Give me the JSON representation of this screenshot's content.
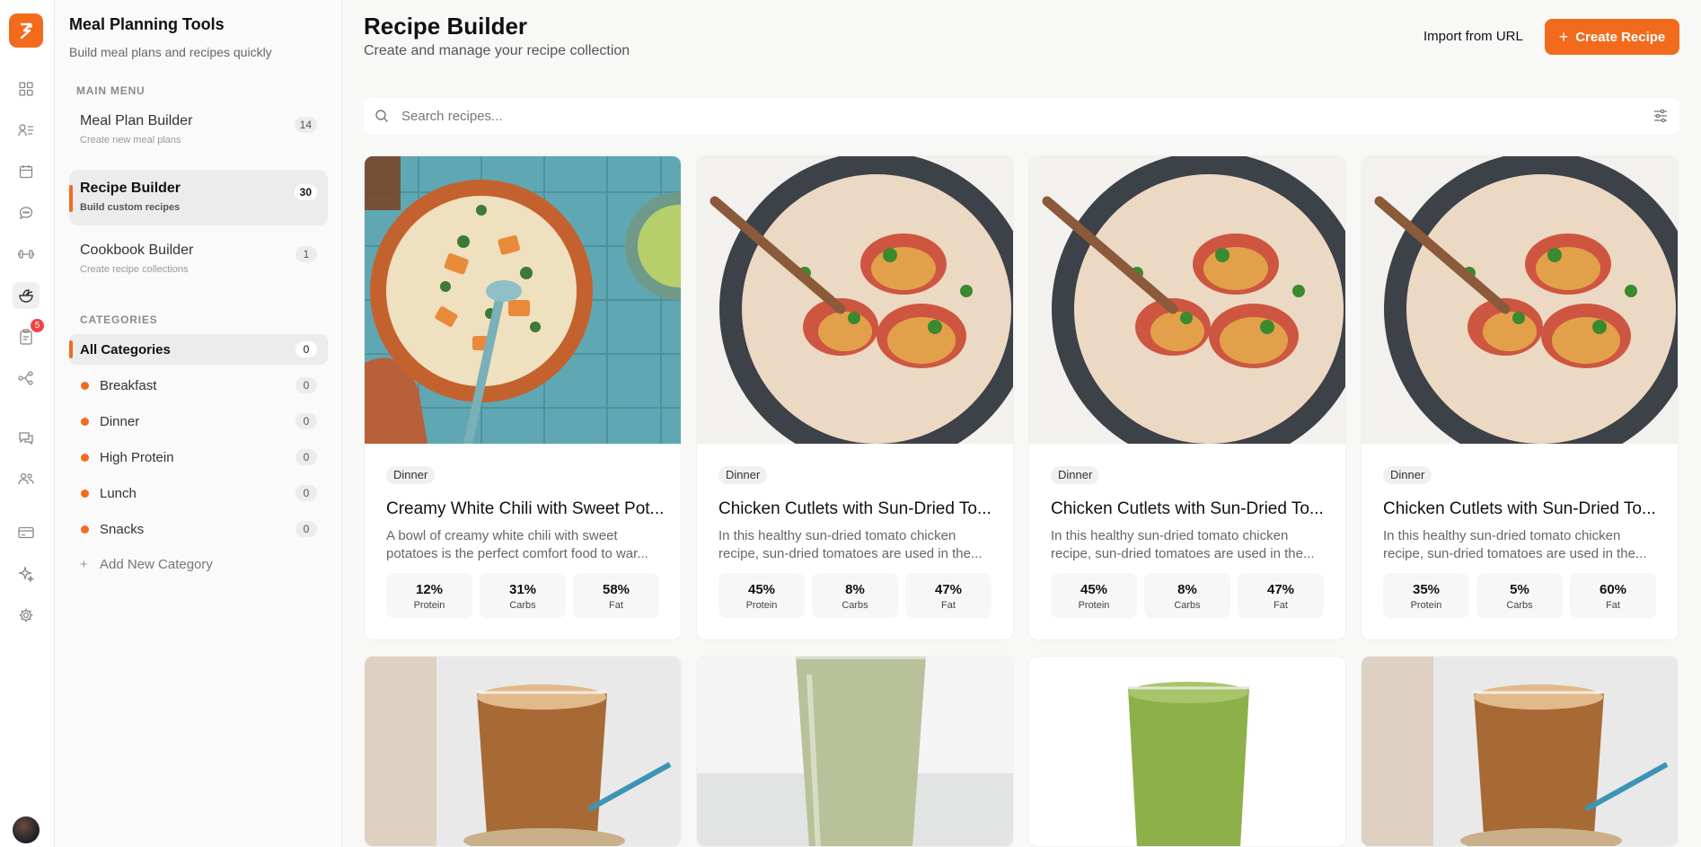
{
  "app": {
    "title": "Meal Planning Tools",
    "subtitle": "Build meal plans and recipes quickly",
    "brand_color": "#f26b1d"
  },
  "rail": {
    "icons": [
      "grid-icon",
      "users-list-icon",
      "calendar-icon",
      "chat-bubble-icon",
      "dumbbell-icon",
      "salad-bowl-icon",
      "clipboard-icon",
      "workflow-icon",
      "messages-icon",
      "team-icon",
      "credit-card-icon",
      "sparkle-icon",
      "settings-icon"
    ],
    "clipboard_badge": "5"
  },
  "sidebar": {
    "main_menu_label": "MAIN MENU",
    "nav": [
      {
        "label": "Meal Plan Builder",
        "desc": "Create new meal plans",
        "count": "14"
      },
      {
        "label": "Recipe Builder",
        "desc": "Build custom recipes",
        "count": "30"
      },
      {
        "label": "Cookbook Builder",
        "desc": "Create recipe collections",
        "count": "1"
      }
    ],
    "categories_label": "CATEGORIES",
    "categories": [
      {
        "label": "All Categories",
        "count": "0"
      },
      {
        "label": "Breakfast",
        "count": "0"
      },
      {
        "label": "Dinner",
        "count": "0"
      },
      {
        "label": "High Protein",
        "count": "0"
      },
      {
        "label": "Lunch",
        "count": "0"
      },
      {
        "label": "Snacks",
        "count": "0"
      }
    ],
    "add_category": "Add New Category"
  },
  "header": {
    "title": "Recipe Builder",
    "subtitle": "Create and manage your recipe collection",
    "import_label": "Import from URL",
    "create_label": "Create Recipe"
  },
  "search": {
    "placeholder": "Search recipes..."
  },
  "recipes": [
    {
      "category": "Dinner",
      "title": "Creamy White Chili with Sweet Pot...",
      "desc": "A bowl of creamy white chili with sweet potatoes is the perfect comfort food to war...",
      "protein": "12%",
      "carbs": "31%",
      "fat": "58%",
      "image": "soup"
    },
    {
      "category": "Dinner",
      "title": "Chicken Cutlets with Sun-Dried To...",
      "desc": "In this healthy sun-dried tomato chicken recipe, sun-dried tomatoes are used in the...",
      "protein": "45%",
      "carbs": "8%",
      "fat": "47%",
      "image": "skillet"
    },
    {
      "category": "Dinner",
      "title": "Chicken Cutlets with Sun-Dried To...",
      "desc": "In this healthy sun-dried tomato chicken recipe, sun-dried tomatoes are used in the...",
      "protein": "45%",
      "carbs": "8%",
      "fat": "47%",
      "image": "skillet"
    },
    {
      "category": "Dinner",
      "title": "Chicken Cutlets with Sun-Dried To...",
      "desc": "In this healthy sun-dried tomato chicken recipe, sun-dried tomatoes are used in the...",
      "protein": "35%",
      "carbs": "5%",
      "fat": "60%",
      "image": "skillet"
    }
  ],
  "macro_labels": {
    "protein": "Protein",
    "carbs": "Carbs",
    "fat": "Fat"
  }
}
